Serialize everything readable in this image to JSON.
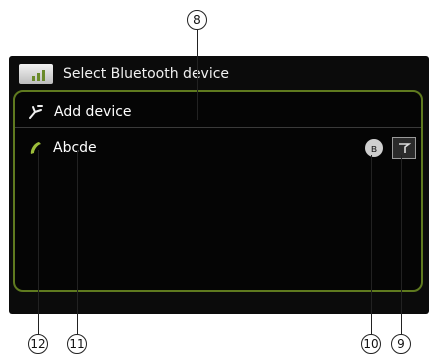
{
  "header": {
    "title": "Select Bluetooth device",
    "icon": "bluetooth-device-icon"
  },
  "list": {
    "add_device": {
      "label": "Add device",
      "icon": "add-device-icon"
    },
    "device": {
      "name": "Abcde",
      "icon": "phone-icon",
      "status_icon": "bluetooth-status-icon",
      "button_icon": "signal-icon"
    }
  },
  "callouts": {
    "c8": "8",
    "c9": "9",
    "c10": "10",
    "c11": "11",
    "c12": "12"
  },
  "colors": {
    "frame_accent": "#5f7a1f",
    "background": "#0b0b0b",
    "text": "#ffffff"
  }
}
